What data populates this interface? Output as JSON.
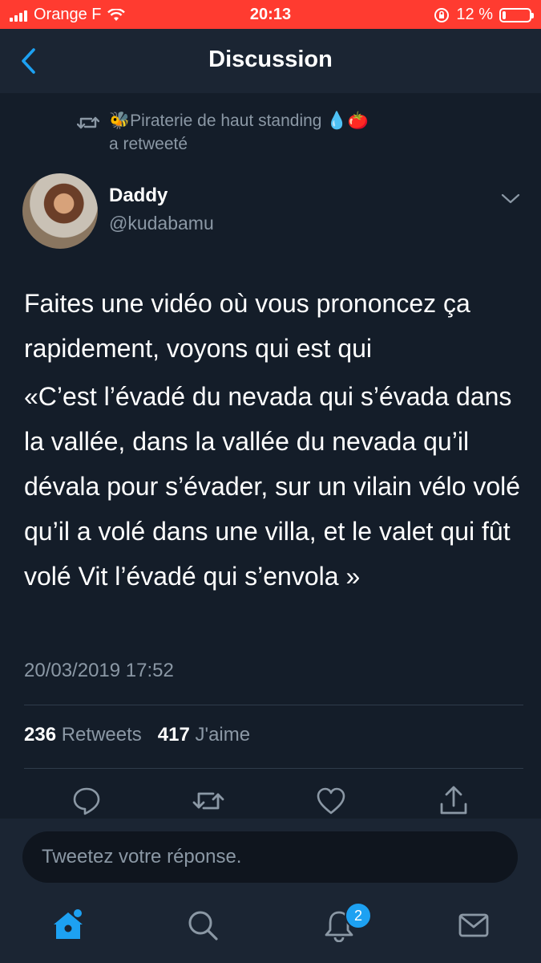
{
  "status_bar": {
    "carrier": "Orange F",
    "time": "20:13",
    "battery_percent": "12 %",
    "battery_level": 0.12,
    "background_color": "#ff3b30"
  },
  "navbar": {
    "title": "Discussion",
    "back_icon": "chevron-left-icon",
    "background_color": "#1b2533"
  },
  "retweet_context": {
    "icon": "retweet-icon",
    "retweeter_name": "🐝Piraterie de haut standing 💧🍅",
    "label": "a retweeté"
  },
  "tweet": {
    "author_name": "Daddy",
    "author_handle": "@kudabamu",
    "paragraphs": [
      "Faites une vidéo où vous prononcez ça rapidement, voyons qui est qui",
      "«C’est l’évadé du nevada qui s’évada dans la vallée, dans la vallée du nevada qu’il dévala pour s’évader, sur un vilain vélo volé qu’il a volé dans une villa, et le valet qui fût volé Vit l’évadé qui s’envola »"
    ],
    "timestamp": "20/03/2019 17:52",
    "retweet_count": "236",
    "retweet_label": "Retweets",
    "like_count": "417",
    "like_label": "J'aime"
  },
  "actions": [
    "reply-icon",
    "retweet-icon",
    "like-heart-icon",
    "share-icon"
  ],
  "reply": {
    "placeholder": "Tweetez votre réponse."
  },
  "tabbar": {
    "tabs": [
      "home-icon",
      "search-icon",
      "notifications-bell-icon",
      "messages-envelope-icon"
    ],
    "notifications_badge": "2",
    "active_color": "#1da1f2",
    "inactive_color": "#8b98a5"
  },
  "colors": {
    "background": "#141d29",
    "secondary_text": "#8b98a5",
    "accent": "#1da1f2"
  }
}
